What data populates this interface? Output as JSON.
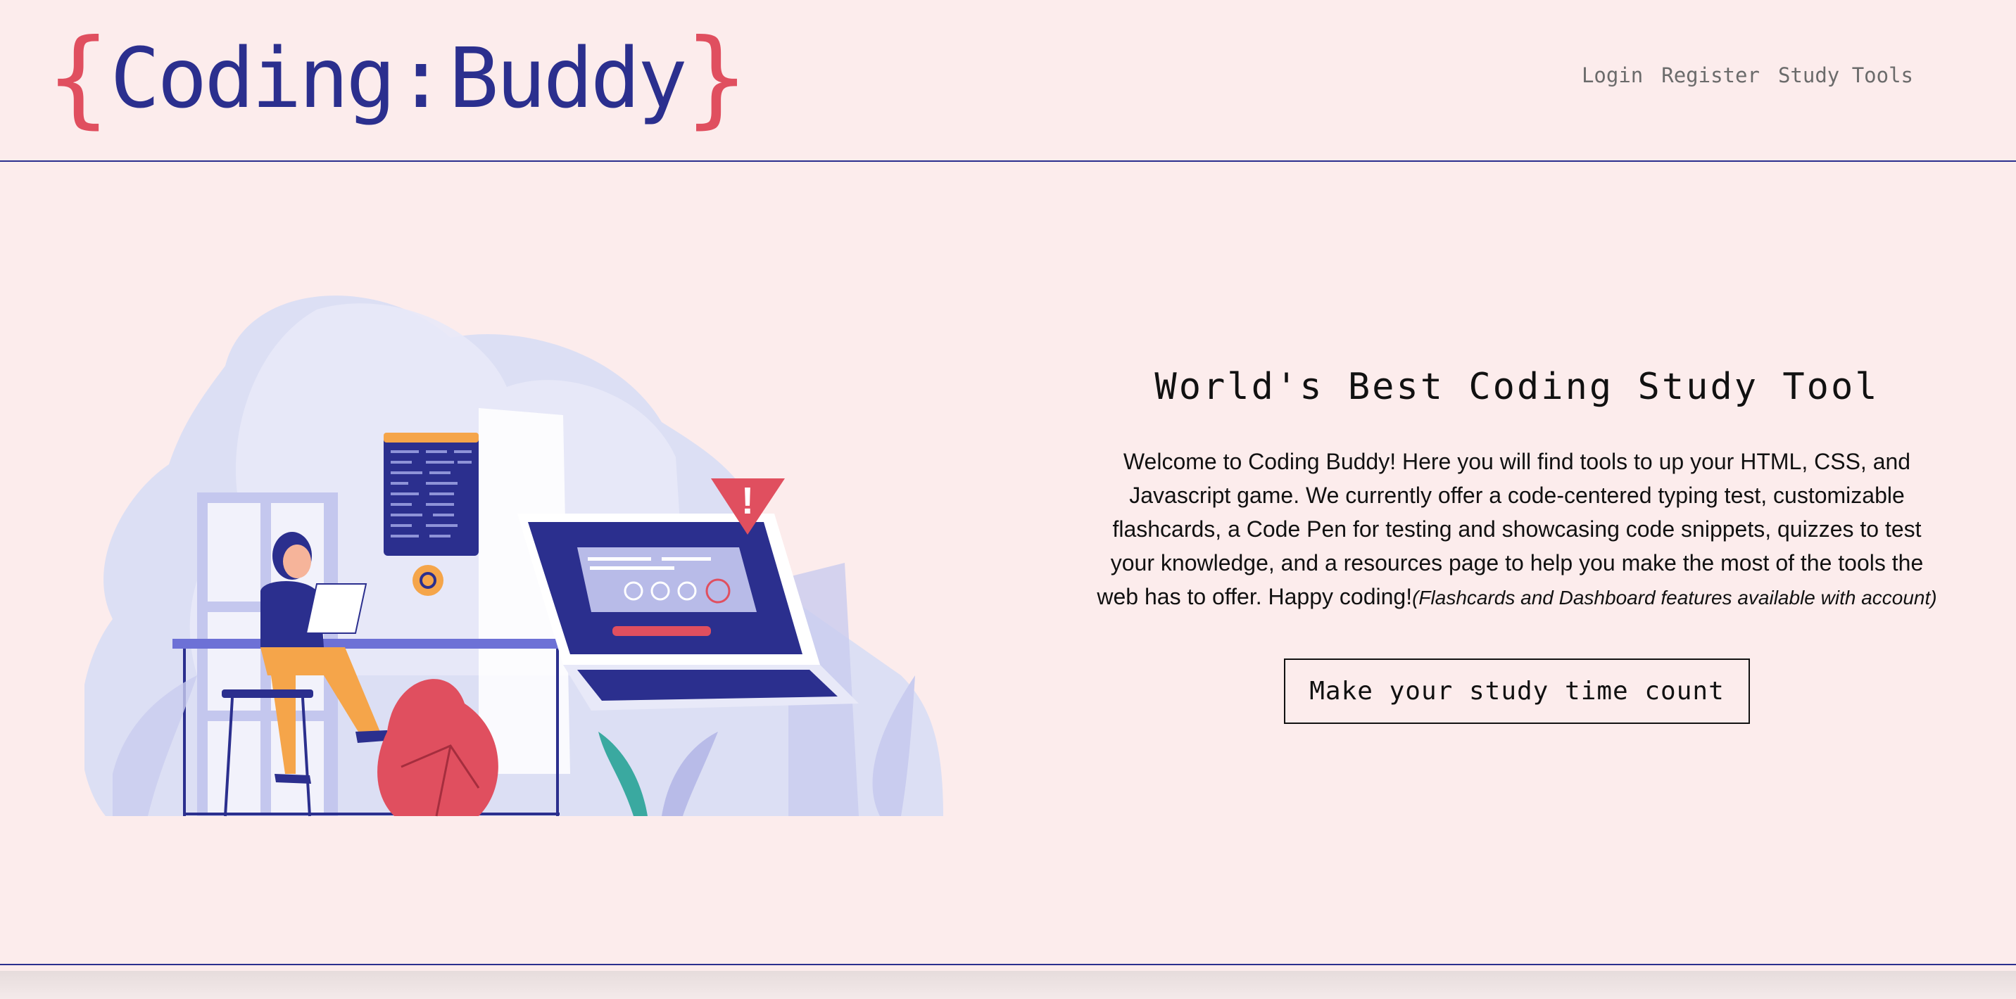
{
  "logo": {
    "open_brace": "{",
    "word1": "Coding",
    "colon": ":",
    "word2": "Buddy",
    "close_brace": "}"
  },
  "nav": {
    "login": "Login",
    "register": "Register",
    "study_tools": "Study Tools"
  },
  "hero": {
    "title": "World's Best Coding Study Tool",
    "body": "Welcome to Coding Buddy! Here you will find tools to up your HTML, CSS, and Javascript game. We currently offer a code-centered typing test, customizable flashcards, a Code Pen for testing and showcasing code snippets, quizzes to test your knowledge, and a resources page to help you make the most of the tools the web has to offer. Happy coding!",
    "note": "(Flashcards and Dashboard features available with account)",
    "cta_label": "Make your study time count"
  },
  "illustration": {
    "alert_mark": "!",
    "colors": {
      "navy": "#2b2f8e",
      "accent_red": "#e04f5f",
      "lavender": "#d7d9f3",
      "orange": "#f5a54a"
    }
  },
  "colors": {
    "background": "#fcecec",
    "brand_navy": "#2b2f8e",
    "brand_red": "#e04f5f"
  }
}
